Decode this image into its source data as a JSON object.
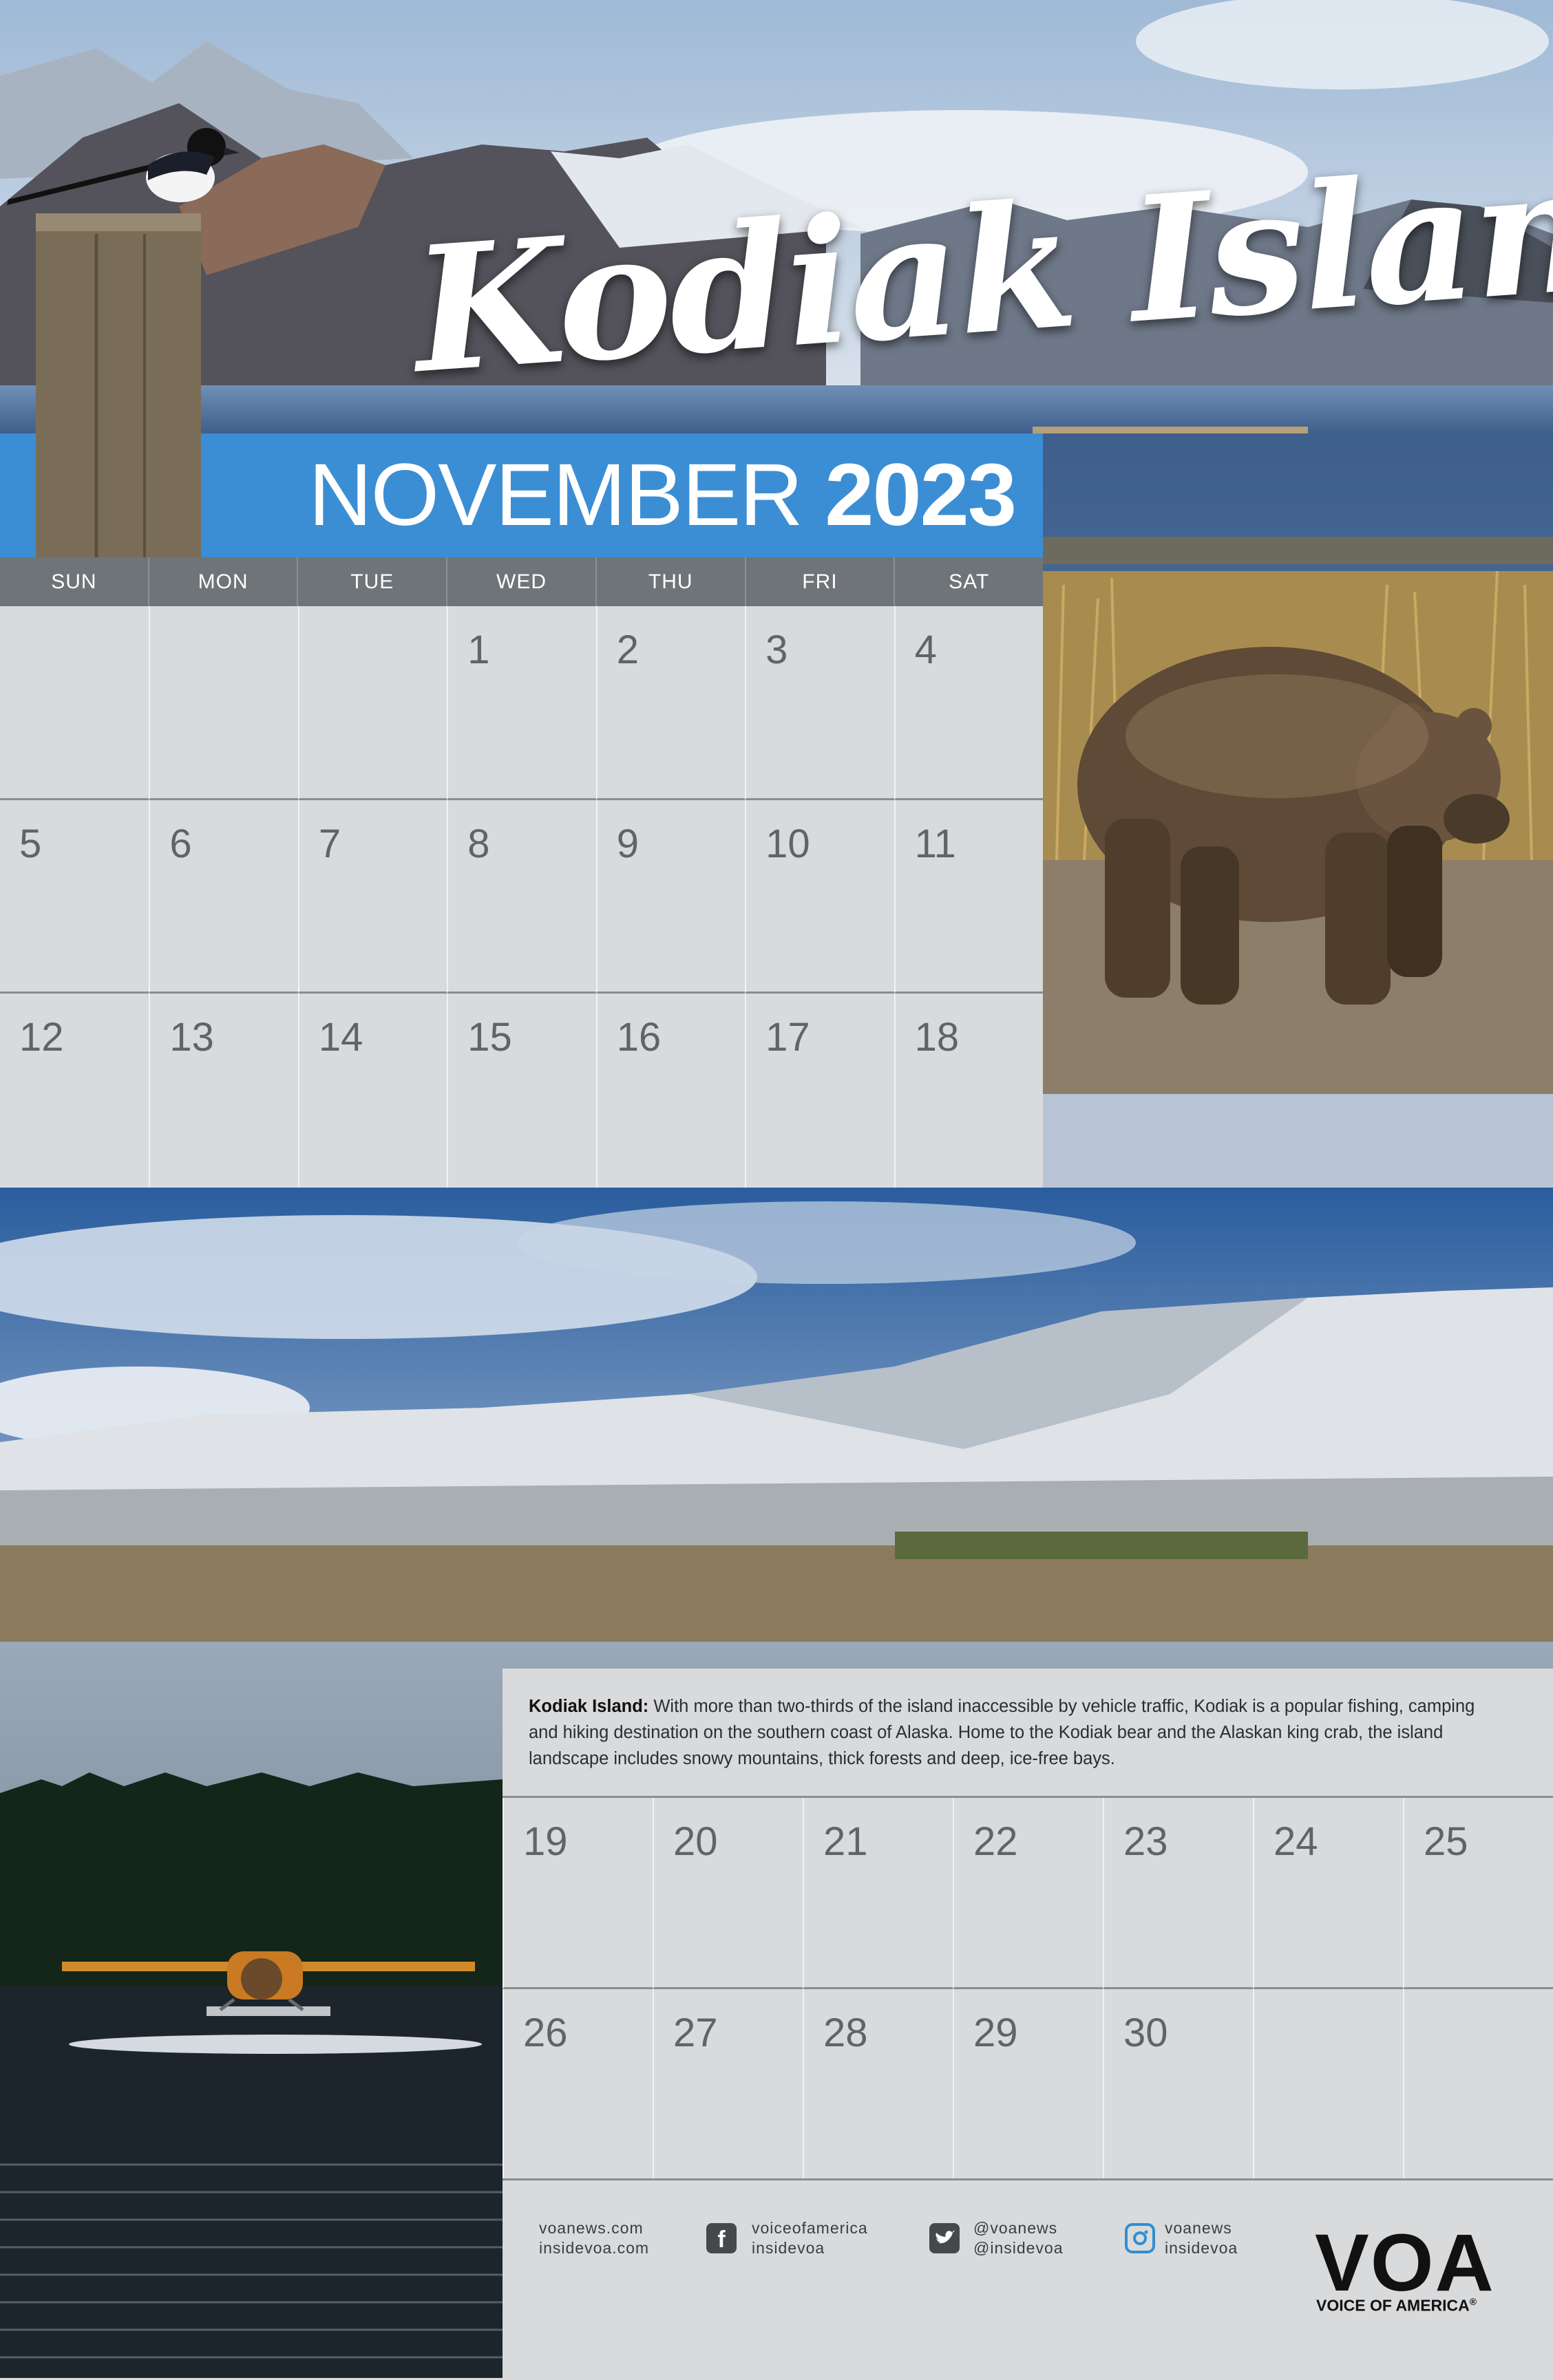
{
  "title": "Kodiak Island",
  "month": "NOVEMBER",
  "year": "2023",
  "weekdays": [
    "SUN",
    "MON",
    "TUE",
    "WED",
    "THU",
    "FRI",
    "SAT"
  ],
  "weeks_top": [
    [
      "",
      "",
      "",
      "1",
      "2",
      "3",
      "4"
    ],
    [
      "5",
      "6",
      "7",
      "8",
      "9",
      "10",
      "11"
    ],
    [
      "12",
      "13",
      "14",
      "15",
      "16",
      "17",
      "18"
    ]
  ],
  "weeks_bottom": [
    [
      "19",
      "20",
      "21",
      "22",
      "23",
      "24",
      "25"
    ],
    [
      "26",
      "27",
      "28",
      "29",
      "30",
      "",
      ""
    ]
  ],
  "info": {
    "heading": "Kodiak Island:",
    "body": " With more than two-thirds of the island inaccessible by vehicle traffic, Kodiak is a popular fishing, camping and hiking destination on the southern coast of Alaska. Home to the Kodiak bear and the Alaskan king crab, the island landscape includes snowy mountains, thick forests and deep, ice-free bays."
  },
  "footer": {
    "web": [
      "voanews.com",
      "insidevoa.com"
    ],
    "facebook": [
      "voiceofamerica",
      "insidevoa"
    ],
    "twitter": [
      "@voanews",
      "@insidevoa"
    ],
    "instagram": [
      "voanews",
      "insidevoa"
    ],
    "logo_text": "VOA",
    "tagline": "VOICE OF AMERICA",
    "registered": "®"
  },
  "icons": {
    "facebook": "facebook-icon",
    "twitter": "twitter-icon",
    "instagram": "instagram-icon"
  },
  "colors": {
    "banner": "#3b8ed4",
    "header": "#6f7478",
    "grid_bg": "#d9dadc",
    "instagram": "#2f8fd2"
  }
}
